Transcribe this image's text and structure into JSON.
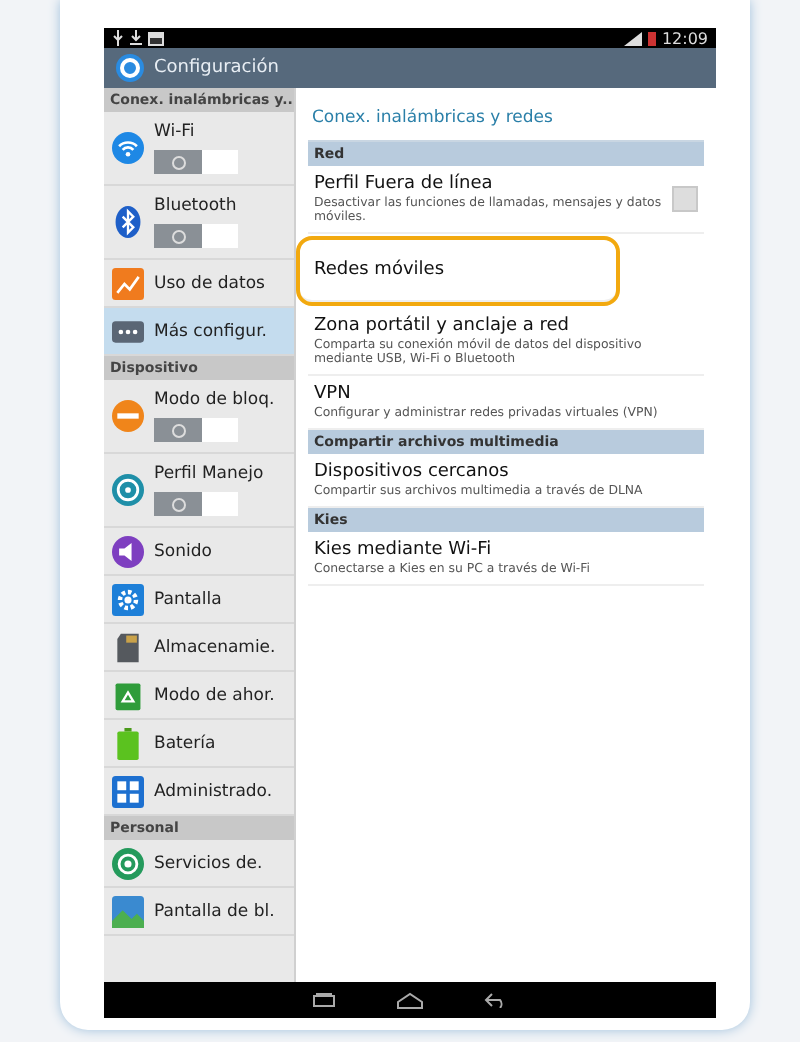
{
  "status_bar": {
    "time": "12:09"
  },
  "action_bar": {
    "title": "Configuración"
  },
  "sidebar": {
    "sections": [
      {
        "header": "Conex. inalámbricas y...",
        "items": [
          {
            "label": "Wi-Fi",
            "kind": "toggle",
            "on": false,
            "selected": false
          },
          {
            "label": "Bluetooth",
            "kind": "toggle",
            "on": false,
            "selected": false
          },
          {
            "label": "Uso de datos",
            "kind": "plain",
            "selected": false
          },
          {
            "label": "Más configur.",
            "kind": "plain",
            "selected": true
          }
        ]
      },
      {
        "header": "Dispositivo",
        "items": [
          {
            "label": "Modo de bloq.",
            "kind": "toggle",
            "on": false,
            "selected": false
          },
          {
            "label": "Perfil Manejo",
            "kind": "toggle",
            "on": false,
            "selected": false
          },
          {
            "label": "Sonido",
            "kind": "plain",
            "selected": false
          },
          {
            "label": "Pantalla",
            "kind": "plain",
            "selected": false
          },
          {
            "label": "Almacenamie.",
            "kind": "plain",
            "selected": false
          },
          {
            "label": "Modo de ahor.",
            "kind": "plain",
            "selected": false
          },
          {
            "label": "Batería",
            "kind": "plain",
            "selected": false
          },
          {
            "label": "Administrado.",
            "kind": "plain",
            "selected": false
          }
        ]
      },
      {
        "header": "Personal",
        "items": [
          {
            "label": "Servicios de.",
            "kind": "plain",
            "selected": false
          },
          {
            "label": "Pantalla de bl.",
            "kind": "plain",
            "selected": false
          }
        ]
      }
    ]
  },
  "content": {
    "title": "Conex. inalámbricas y redes",
    "sections": [
      {
        "header": "Red",
        "items": [
          {
            "title": "Perfil Fuera de línea",
            "summary": "Desactivar las funciones de llamadas, mensajes y datos móviles.",
            "kind": "checkbox",
            "checked": false,
            "highlighted": false
          },
          {
            "title": "Redes móviles",
            "kind": "plain",
            "highlighted": true
          },
          {
            "title": "Zona portátil y anclaje a red",
            "summary": "Comparta su conexión móvil de datos del dispositivo mediante USB, Wi-Fi o Bluetooth",
            "kind": "plain",
            "highlighted": false
          },
          {
            "title": "VPN",
            "summary": "Configurar y administrar redes privadas virtuales (VPN)",
            "kind": "plain",
            "highlighted": false
          }
        ]
      },
      {
        "header": "Compartir archivos multimedia",
        "items": [
          {
            "title": "Dispositivos cercanos",
            "summary": "Compartir sus archivos multimedia a través de DLNA",
            "kind": "plain",
            "highlighted": false
          }
        ]
      },
      {
        "header": "Kies",
        "items": [
          {
            "title": "Kies mediante Wi-Fi",
            "summary": "Conectarse a Kies en su PC a través de Wi-Fi",
            "kind": "plain",
            "highlighted": false
          }
        ]
      }
    ]
  }
}
